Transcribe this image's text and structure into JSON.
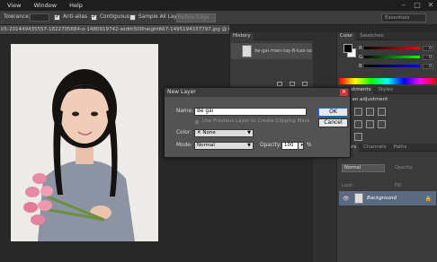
{
  "menubar": {
    "items": [
      "View",
      "Window",
      "Help"
    ],
    "controls": [
      "–",
      "□",
      "✕"
    ]
  },
  "options": {
    "tolerance_label": "Tolerance:",
    "antialias_label": "Anti-alias",
    "contiguous_label": "Contiguous",
    "sample_all_label": "Sample All Layers",
    "refine_edge_label": "Refine Edge...",
    "workspace_value": "Essentials"
  },
  "document": {
    "tab_title": "05-201449435557-1822705684-o-1480919742-width500height667-1495194337797.jpg @ 66.7% (RGB/8#)"
  },
  "history": {
    "tab_label": "History",
    "item_name": "be-gai-mien-tay-8-tuoi-so..."
  },
  "color_panel": {
    "tabs": [
      "Color",
      "Swatches"
    ],
    "channels": [
      {
        "ch": "R",
        "value": "0",
        "gradient": "linear-gradient(to right,#000,#f00)"
      },
      {
        "ch": "G",
        "value": "0",
        "gradient": "linear-gradient(to right,#000,#0f0)"
      },
      {
        "ch": "B",
        "value": "0",
        "gradient": "linear-gradient(to right,#000,#00f)"
      }
    ]
  },
  "adjust_panel": {
    "tabs": [
      "Adjustments",
      "Styles"
    ],
    "title": "Add an adjustment"
  },
  "layers_panel": {
    "tabs": [
      "Layers",
      "Channels",
      "Paths"
    ],
    "blend_mode": "Normal",
    "opacity_label": "Opacity:",
    "lock_label": "Lock:",
    "fill_label": "Fill:",
    "layer_name": "Background"
  },
  "dialog": {
    "title": "New Layer",
    "name_label": "Name:",
    "name_value": "Bé gái",
    "clip_label": "Use Previous Layer to Create Clipping Mask",
    "color_label": "Color:",
    "color_value": "None",
    "mode_label": "Mode:",
    "mode_value": "Normal",
    "opacity_label": "Opacity:",
    "opacity_value": "100",
    "percent": "%",
    "ok_label": "OK",
    "cancel_label": "Cancel"
  }
}
